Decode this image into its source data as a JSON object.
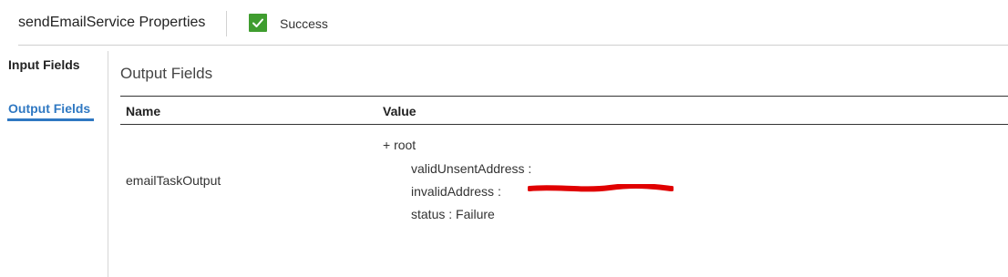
{
  "header": {
    "title": "sendEmailService Properties",
    "status_text": "Success",
    "status_icon": "check-icon",
    "status_color": "#3f9d2f"
  },
  "sidebar": {
    "items": [
      {
        "label": "Input Fields",
        "active": false
      },
      {
        "label": "Output Fields",
        "active": true
      }
    ],
    "accent_color": "#2f78c2"
  },
  "main": {
    "section_title": "Output Fields",
    "table": {
      "columns": [
        "Name",
        "Value"
      ],
      "rows": [
        {
          "name": "emailTaskOutput",
          "value": {
            "root": "+ root",
            "fields": [
              {
                "label": "validUnsentAddress :"
              },
              {
                "label": "invalidAddress :",
                "redacted": true
              },
              {
                "label": "status : Failure"
              }
            ]
          }
        }
      ]
    },
    "redaction_color": "#e00000"
  }
}
